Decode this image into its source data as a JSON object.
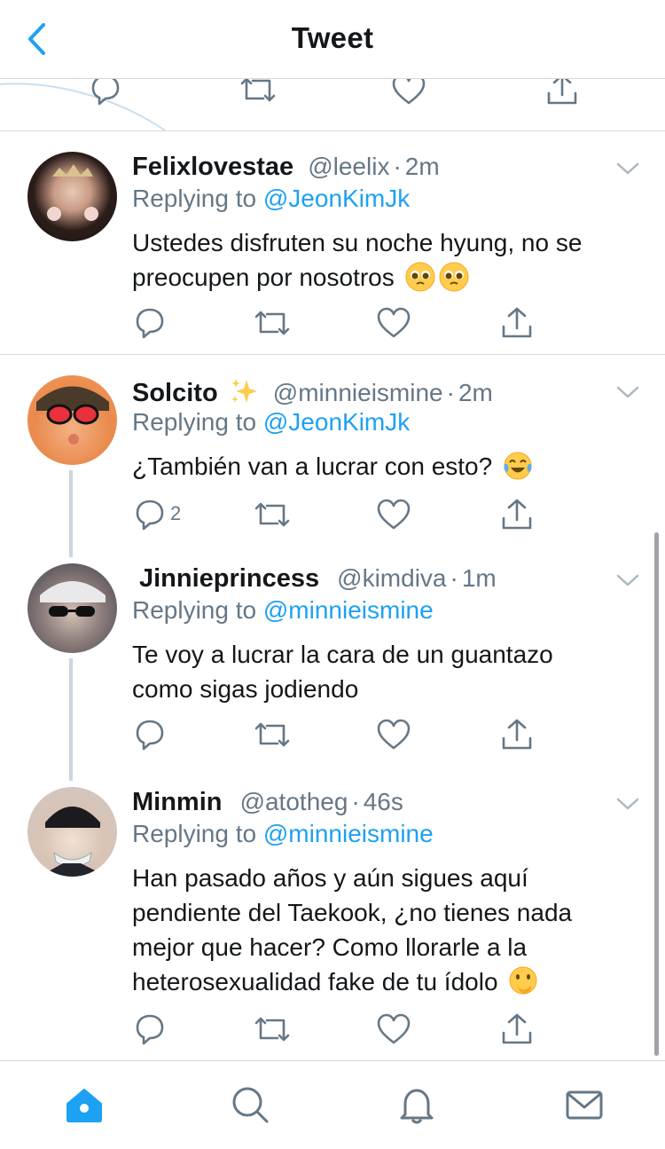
{
  "header": {
    "title": "Tweet",
    "back_icon": "chevron-left-icon"
  },
  "colors": {
    "accent": "#1da1f2",
    "muted": "#657786",
    "divider": "#d6d9dc"
  },
  "tweets": [
    {
      "display_name": "Felixlovestae",
      "handle": "@leelix",
      "sep": "·",
      "time": "2m",
      "reply_prefix": "Replying to",
      "reply_to": "@JeonKimJk",
      "text": "Ustedes disfruten su noche hyung, no se preocupen por nosotros",
      "emoji": [
        "pleading-face",
        "pleading-face"
      ]
    },
    {
      "display_name": "Solcito",
      "handle": "@minnieismine",
      "sep": "·",
      "time": "2m",
      "reply_prefix": "Replying to",
      "reply_to": "@JeonKimJk",
      "text": "¿También van a lucrar con esto?",
      "emoji": [
        "tears-of-joy"
      ],
      "name_emoji": "sparkles",
      "reply_count": "2"
    },
    {
      "display_name": "Jinnieprincess",
      "handle": "@kimdiva",
      "sep": "·",
      "time": "1m",
      "reply_prefix": "Replying to",
      "reply_to": "@minnieismine",
      "text_lines": [
        "Te voy a lucrar la cara de un guantazo",
        "como sigas jodiendo"
      ]
    },
    {
      "display_name": "Minmin",
      "handle": "@atotheg",
      "sep": "·",
      "time": "46s",
      "reply_prefix": "Replying to",
      "reply_to": "@minnieismine",
      "text_lines": [
        "Han pasado años y aún sigues aquí",
        "pendiente del Taekook, ¿no tienes nada",
        "mejor que hacer? Como llorarle a la",
        "heterosexualidad fake de tu ídolo"
      ],
      "emoji": [
        "face-with-hand-over-mouth"
      ]
    }
  ],
  "tabbar": [
    "home-icon",
    "search-icon",
    "notifications-icon",
    "messages-icon"
  ]
}
